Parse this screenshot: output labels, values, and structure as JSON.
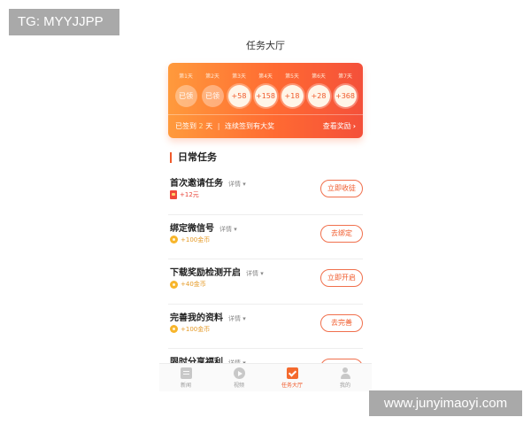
{
  "watermarks": {
    "top_left": "TG: MYYJJPP",
    "bottom_right": "www.junyimaoyi.com"
  },
  "page_title": "任务大厅",
  "sign_in": {
    "days": [
      {
        "label": "第1天",
        "value": "已领",
        "state": "done"
      },
      {
        "label": "第2天",
        "value": "已领",
        "state": "done"
      },
      {
        "label": "第3天",
        "value": "+58",
        "state": "todo"
      },
      {
        "label": "第4天",
        "value": "+158",
        "state": "todo"
      },
      {
        "label": "第5天",
        "value": "+18",
        "state": "todo"
      },
      {
        "label": "第6天",
        "value": "+28",
        "state": "todo"
      },
      {
        "label": "第7天",
        "value": "+368",
        "state": "todo"
      }
    ],
    "signed_prefix": "已签到",
    "signed_count": "2",
    "signed_suffix": "天",
    "separator": "|",
    "streak_text": "连续签到有大奖",
    "view_rewards": "查看奖励",
    "chevron": "›"
  },
  "section_title": "日常任务",
  "tasks": [
    {
      "name": "首次邀请任务",
      "detail": "详情",
      "reward": "+12元",
      "reward_kind": "cash",
      "button": "立即收徒"
    },
    {
      "name": "绑定微信号",
      "detail": "详情",
      "reward": "+100金币",
      "reward_kind": "coin",
      "button": "去绑定"
    },
    {
      "name": "下载奖励检测开启",
      "detail": "详情",
      "reward": "+40金币",
      "reward_kind": "coin",
      "button": "立即开启"
    },
    {
      "name": "完善我的资料",
      "detail": "详情",
      "reward": "+100金币",
      "reward_kind": "coin",
      "button": "去完善"
    },
    {
      "name": "限时分享福利",
      "detail": "详情",
      "reward": "",
      "reward_kind": "coin",
      "button": ""
    }
  ],
  "tabbar": [
    {
      "label": "新闻",
      "icon": "news-icon",
      "active": false
    },
    {
      "label": "视频",
      "icon": "video-icon",
      "active": false
    },
    {
      "label": "任务大厅",
      "icon": "task-icon",
      "active": true
    },
    {
      "label": "我的",
      "icon": "profile-icon",
      "active": false
    }
  ],
  "colors": {
    "accent": "#f05a2b",
    "card_start": "#ff9a3c",
    "card_end": "#f4503a",
    "coin": "#f7b52b"
  }
}
